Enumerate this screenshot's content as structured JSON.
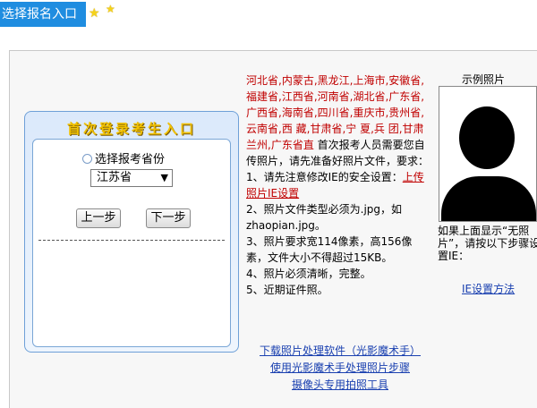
{
  "header": {
    "tab_label": "选择报名入口"
  },
  "panel": {
    "title": "首次登录考生入口",
    "radio_label": "选择报考省份",
    "province_select": "江苏省",
    "prev_button": "上一步",
    "next_button": "下一步"
  },
  "info": {
    "provinces": "河北省,内蒙古,黑龙江,上海市,安徽省,福建省,江西省,河南省,湖北省,广东省,广西省,海南省,四川省,重庆市,贵州省,云南省,西 藏,甘肃省,宁 夏,兵 团,甘肃兰州,广东省直",
    "intro": " 首次报考人员需要您自传照片，请先准备好照片文件，要求：",
    "step1_prefix": "1、请先注意修改IE的安全设置：",
    "step1_link": "上传照片IE设置",
    "step2a": "2、照片文件类型必须为.jpg，如",
    "step2b": "zhaopian.jpg。",
    "step3": "3、照片要求宽114像素，高156像素，文件大小不得超过15KB。",
    "step4": "4、照片必须清晰，完整。",
    "step5": "5、近期证件照。"
  },
  "links": {
    "download_tool": "下载照片处理软件（光影魔术手）",
    "tool_steps": "使用光影魔术手处理照片步骤",
    "camera_tool": "摄像头专用拍照工具"
  },
  "photo": {
    "label": "示例照片",
    "note": "如果上面显示“无照片”，请按以下步骤设置IE：",
    "ie_link": "IE设置方法"
  },
  "colors": {
    "tab_bg": "#1f8de0",
    "red_text": "#c00000",
    "link_blue": "#1a40b0",
    "panel_border": "#6ea0d8"
  },
  "icons": [
    "star-icon",
    "star-icon",
    "radio-icon",
    "chevron-down-icon",
    "person-silhouette"
  ]
}
